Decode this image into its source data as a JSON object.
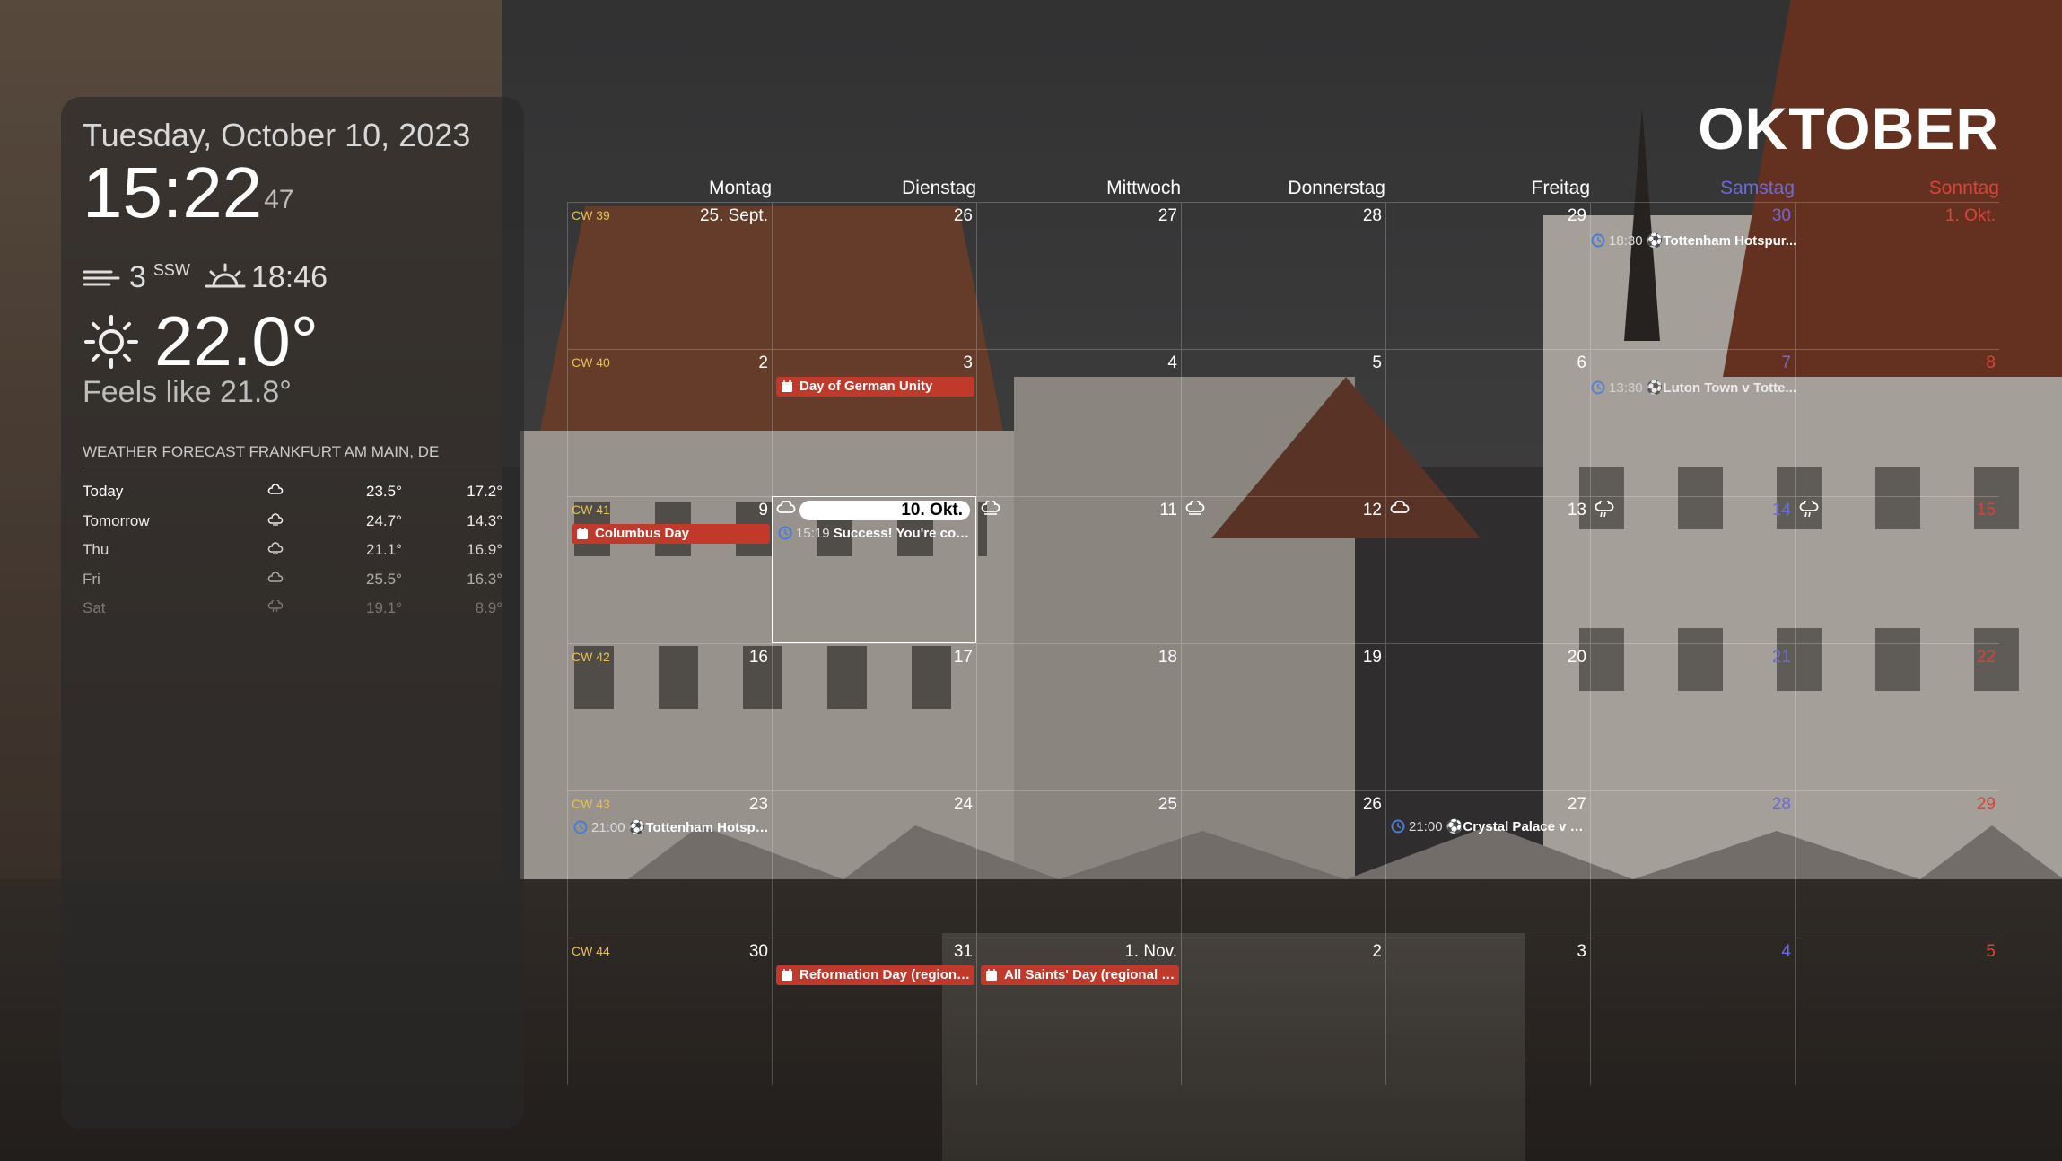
{
  "clock": {
    "date": "Tuesday, October 10, 2023",
    "time": "15:22",
    "seconds": "47"
  },
  "weather": {
    "wind_speed": "3",
    "wind_dir": "SSW",
    "sunset": "18:46",
    "temperature": "22.0°",
    "feels_like": "Feels like 21.8°",
    "forecast_title": "WEATHER FORECAST FRANKFURT AM MAIN, DE",
    "forecast": [
      {
        "day": "Today",
        "icon": "partly-cloudy-icon",
        "max": "23.5°",
        "min": "17.2°"
      },
      {
        "day": "Tomorrow",
        "icon": "cloudy-icon",
        "max": "24.7°",
        "min": "14.3°"
      },
      {
        "day": "Thu",
        "icon": "cloudy-icon",
        "max": "21.1°",
        "min": "16.9°"
      },
      {
        "day": "Fri",
        "icon": "partly-cloudy-icon",
        "max": "25.5°",
        "min": "16.3°"
      },
      {
        "day": "Sat",
        "icon": "rain-icon",
        "max": "19.1°",
        "min": "8.9°"
      }
    ]
  },
  "calendar": {
    "month": "OKTOBER",
    "weekdays": [
      "Montag",
      "Dienstag",
      "Mittwoch",
      "Donnerstag",
      "Freitag",
      "Samstag",
      "Sonntag"
    ],
    "weeks": [
      {
        "cw": "CW 39",
        "days": [
          "25. Sept.",
          "26",
          "27",
          "28",
          "29",
          "30",
          "1. Okt."
        ]
      },
      {
        "cw": "CW 40",
        "days": [
          "2",
          "3",
          "4",
          "5",
          "6",
          "7",
          "8"
        ]
      },
      {
        "cw": "CW 41",
        "days": [
          "9",
          "10. Okt.",
          "11",
          "12",
          "13",
          "14",
          "15"
        ]
      },
      {
        "cw": "CW 42",
        "days": [
          "16",
          "17",
          "18",
          "19",
          "20",
          "21",
          "22"
        ]
      },
      {
        "cw": "CW 43",
        "days": [
          "23",
          "24",
          "25",
          "26",
          "27",
          "28",
          "29"
        ]
      },
      {
        "cw": "CW 44",
        "days": [
          "30",
          "31",
          "1. Nov.",
          "2",
          "3",
          "4",
          "5"
        ]
      }
    ],
    "events": {
      "w0_sat": {
        "time": "18:30",
        "title": "Tottenham Hotspur..."
      },
      "w1_tue": {
        "title": "Day of German Unity"
      },
      "w1_sat": {
        "time": "13:30",
        "title": "Luton Town v Totte..."
      },
      "w2_mon": {
        "title": "Columbus Day"
      },
      "w2_tue": {
        "time": "15:19",
        "title": "Success! You're conn..."
      },
      "w4_mon": {
        "time": "21:00",
        "title": "Tottenham Hotspur..."
      },
      "w4_thu": {
        "time": "21:00",
        "title": "Crystal Palace v To..."
      },
      "w5_tue": {
        "title": "Reformation Day (regional h..."
      },
      "w5_wed": {
        "title": "All Saints' Day (regional holi..."
      }
    }
  },
  "colors": {
    "holiday": "#c0392b",
    "saturday": "#6a6cd9",
    "sunday": "#d8443a",
    "cw": "#e5c25a"
  }
}
